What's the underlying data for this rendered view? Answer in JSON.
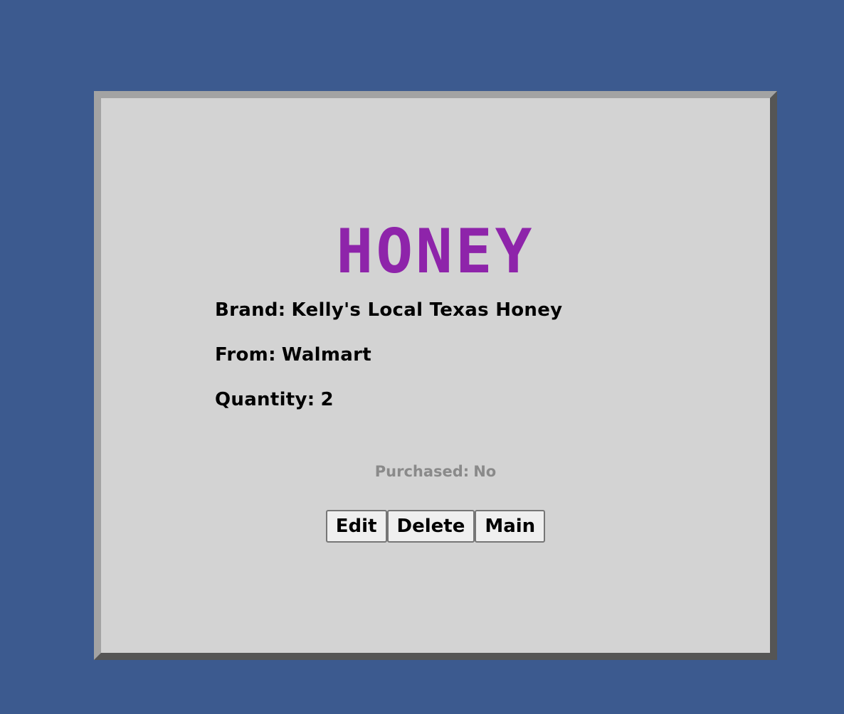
{
  "item": {
    "title": "HONEY",
    "brand_label": "Brand:",
    "brand_value": "Kelly's Local Texas Honey",
    "from_label": "From:",
    "from_value": "Walmart",
    "quantity_label": "Quantity:",
    "quantity_value": "2",
    "purchased_label": "Purchased:",
    "purchased_value": "No"
  },
  "actions": {
    "edit_label": "Edit",
    "delete_label": "Delete",
    "main_label": "Main"
  },
  "colors": {
    "background": "#3c5a8f",
    "card": "#d3d3d3",
    "title": "#8e24aa",
    "muted_text": "#8a8a8a"
  }
}
